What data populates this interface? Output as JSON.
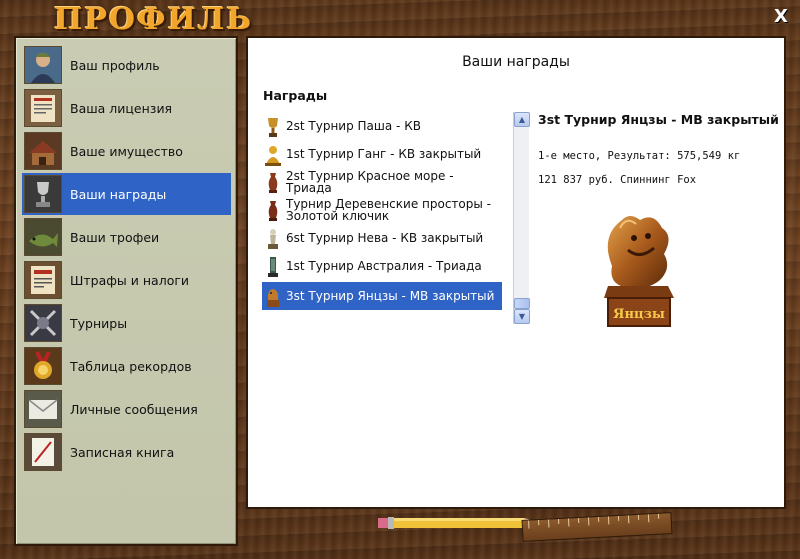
{
  "window": {
    "title": "ПРОФИЛЬ",
    "close_label": "X"
  },
  "sidebar": {
    "items": [
      {
        "label": "Ваш профиль",
        "icon": "fisherman-icon",
        "active": false
      },
      {
        "label": "Ваша лицензия",
        "icon": "license-icon",
        "active": false
      },
      {
        "label": "Ваше имущество",
        "icon": "property-icon",
        "active": false
      },
      {
        "label": "Ваши награды",
        "icon": "award-icon",
        "active": true
      },
      {
        "label": "Ваши трофеи",
        "icon": "fish-trophy-icon",
        "active": false
      },
      {
        "label": "Штрафы и налоги",
        "icon": "fine-document-icon",
        "active": false
      },
      {
        "label": "Турниры",
        "icon": "crossed-rods-icon",
        "active": false
      },
      {
        "label": "Таблица рекордов",
        "icon": "medal-icon",
        "active": false
      },
      {
        "label": "Личные сообщения",
        "icon": "envelope-icon",
        "active": false
      },
      {
        "label": "Записная книга",
        "icon": "notebook-icon",
        "active": false
      }
    ]
  },
  "main": {
    "title": "Ваши награды",
    "list_heading": "Награды",
    "awards": [
      {
        "label": "2st Турнир Паша - КВ",
        "icon": "cup-icon"
      },
      {
        "label": "1st Турнир Ганг - КВ закрытый",
        "icon": "buddha-statue-icon"
      },
      {
        "label": "2st Турнир Красное море - Триада",
        "icon": "vase-icon"
      },
      {
        "label": "Турнир Деревенские просторы - Золотой ключик",
        "icon": "vase-icon"
      },
      {
        "label": "6st Турнир Нева - КВ закрытый",
        "icon": "statuette-icon"
      },
      {
        "label": "1st Турнир Австралия - Триада",
        "icon": "statuette-icon"
      },
      {
        "label": "3st Турнир Янцзы - МВ закрытый",
        "icon": "dragon-icon",
        "selected": true
      }
    ],
    "detail": {
      "title": "3st Турнир Янцзы - МВ закрытый",
      "result": "1-е место, Результат: 575,549 кг",
      "prize": "121 837 руб. Спиннинг Fox",
      "trophy_plaque": "Янцзы"
    }
  },
  "colors": {
    "accent": "#2f64c6",
    "title_gold": "#f2a52b",
    "sidebar_bg": "#c9ccb2"
  }
}
